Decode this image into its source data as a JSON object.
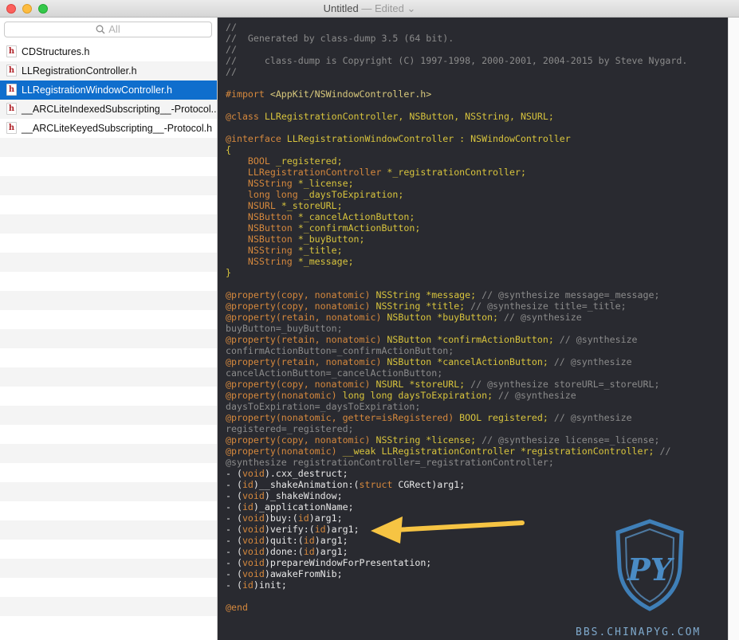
{
  "window": {
    "title": "Untitled",
    "edited": "— Edited",
    "traffic_lights": [
      "close",
      "minimize",
      "maximize"
    ]
  },
  "sidebar": {
    "search_placeholder": "All",
    "files": [
      {
        "name": "CDStructures.h",
        "selected": false
      },
      {
        "name": "LLRegistrationController.h",
        "selected": false
      },
      {
        "name": "LLRegistrationWindowController.h",
        "selected": true
      },
      {
        "name": "__ARCLiteIndexedSubscripting__-Protocol...",
        "selected": false
      },
      {
        "name": "__ARCLiteKeyedSubscripting__-Protocol.h",
        "selected": false
      }
    ]
  },
  "code_lines": [
    [
      {
        "c": "c",
        "t": "//"
      }
    ],
    [
      {
        "c": "c",
        "t": "//  Generated by class-dump 3.5 (64 bit)."
      }
    ],
    [
      {
        "c": "c",
        "t": "//"
      }
    ],
    [
      {
        "c": "c",
        "t": "//     class-dump is Copyright (C) 1997-1998, 2000-2001, 2004-2015 by Steve Nygard."
      }
    ],
    [
      {
        "c": "c",
        "t": "//"
      }
    ],
    [
      {
        "c": "w",
        "t": ""
      }
    ],
    [
      {
        "c": "k",
        "t": "#import "
      },
      {
        "c": "s",
        "t": "<AppKit/NSWindowController.h>"
      }
    ],
    [
      {
        "c": "w",
        "t": ""
      }
    ],
    [
      {
        "c": "k",
        "t": "@class "
      },
      {
        "c": "y",
        "t": "LLRegistrationController, NSButton, NSString, NSURL;"
      }
    ],
    [
      {
        "c": "w",
        "t": ""
      }
    ],
    [
      {
        "c": "k",
        "t": "@interface "
      },
      {
        "c": "y",
        "t": "LLRegistrationWindowController : NSWindowController"
      }
    ],
    [
      {
        "c": "y",
        "t": "{"
      }
    ],
    [
      {
        "c": "k",
        "t": "    BOOL"
      },
      {
        "c": "y",
        "t": " _registered;"
      }
    ],
    [
      {
        "c": "k",
        "t": "    LLRegistrationController"
      },
      {
        "c": "y",
        "t": " *_registrationController;"
      }
    ],
    [
      {
        "c": "k",
        "t": "    NSString"
      },
      {
        "c": "y",
        "t": " *_license;"
      }
    ],
    [
      {
        "c": "k",
        "t": "    long long"
      },
      {
        "c": "y",
        "t": " _daysToExpiration;"
      }
    ],
    [
      {
        "c": "k",
        "t": "    NSURL"
      },
      {
        "c": "y",
        "t": " *_storeURL;"
      }
    ],
    [
      {
        "c": "k",
        "t": "    NSButton"
      },
      {
        "c": "y",
        "t": " *_cancelActionButton;"
      }
    ],
    [
      {
        "c": "k",
        "t": "    NSButton"
      },
      {
        "c": "y",
        "t": " *_confirmActionButton;"
      }
    ],
    [
      {
        "c": "k",
        "t": "    NSButton"
      },
      {
        "c": "y",
        "t": " *_buyButton;"
      }
    ],
    [
      {
        "c": "k",
        "t": "    NSString"
      },
      {
        "c": "y",
        "t": " *_title;"
      }
    ],
    [
      {
        "c": "k",
        "t": "    NSString"
      },
      {
        "c": "y",
        "t": " *_message;"
      }
    ],
    [
      {
        "c": "y",
        "t": "}"
      }
    ],
    [
      {
        "c": "w",
        "t": ""
      }
    ],
    [
      {
        "c": "k",
        "t": "@property(copy, nonatomic) "
      },
      {
        "c": "y",
        "t": "NSString *message;"
      },
      {
        "c": "c",
        "t": " // @synthesize message=_message;"
      }
    ],
    [
      {
        "c": "k",
        "t": "@property(copy, nonatomic) "
      },
      {
        "c": "y",
        "t": "NSString *title;"
      },
      {
        "c": "c",
        "t": " // @synthesize title=_title;"
      }
    ],
    [
      {
        "c": "k",
        "t": "@property(retain, nonatomic) "
      },
      {
        "c": "y",
        "t": "NSButton *buyButton;"
      },
      {
        "c": "c",
        "t": " // @synthesize"
      }
    ],
    [
      {
        "c": "c",
        "t": "buyButton=_buyButton;"
      }
    ],
    [
      {
        "c": "k",
        "t": "@property(retain, nonatomic) "
      },
      {
        "c": "y",
        "t": "NSButton *confirmActionButton;"
      },
      {
        "c": "c",
        "t": " // @synthesize"
      }
    ],
    [
      {
        "c": "c",
        "t": "confirmActionButton=_confirmActionButton;"
      }
    ],
    [
      {
        "c": "k",
        "t": "@property(retain, nonatomic) "
      },
      {
        "c": "y",
        "t": "NSButton *cancelActionButton;"
      },
      {
        "c": "c",
        "t": " // @synthesize"
      }
    ],
    [
      {
        "c": "c",
        "t": "cancelActionButton=_cancelActionButton;"
      }
    ],
    [
      {
        "c": "k",
        "t": "@property(copy, nonatomic) "
      },
      {
        "c": "y",
        "t": "NSURL *storeURL;"
      },
      {
        "c": "c",
        "t": " // @synthesize storeURL=_storeURL;"
      }
    ],
    [
      {
        "c": "k",
        "t": "@property(nonatomic) "
      },
      {
        "c": "y",
        "t": "long long daysToExpiration;"
      },
      {
        "c": "c",
        "t": " // @synthesize"
      }
    ],
    [
      {
        "c": "c",
        "t": "daysToExpiration=_daysToExpiration;"
      }
    ],
    [
      {
        "c": "k",
        "t": "@property(nonatomic, getter=isRegistered) "
      },
      {
        "c": "y",
        "t": "BOOL registered;"
      },
      {
        "c": "c",
        "t": " // @synthesize"
      }
    ],
    [
      {
        "c": "c",
        "t": "registered=_registered;"
      }
    ],
    [
      {
        "c": "k",
        "t": "@property(copy, nonatomic) "
      },
      {
        "c": "y",
        "t": "NSString *license;"
      },
      {
        "c": "c",
        "t": " // @synthesize license=_license;"
      }
    ],
    [
      {
        "c": "k",
        "t": "@property(nonatomic) "
      },
      {
        "c": "y",
        "t": "__weak LLRegistrationController *registrationController;"
      },
      {
        "c": "c",
        "t": " //"
      }
    ],
    [
      {
        "c": "c",
        "t": "@synthesize registrationController=_registrationController;"
      }
    ],
    [
      {
        "c": "w",
        "t": "- ("
      },
      {
        "c": "k",
        "t": "void"
      },
      {
        "c": "w",
        "t": ").cxx_destruct;"
      }
    ],
    [
      {
        "c": "w",
        "t": "- ("
      },
      {
        "c": "k",
        "t": "id"
      },
      {
        "c": "w",
        "t": ")__shakeAnimation:("
      },
      {
        "c": "k",
        "t": "struct"
      },
      {
        "c": "w",
        "t": " CGRect)arg1;"
      }
    ],
    [
      {
        "c": "w",
        "t": "- ("
      },
      {
        "c": "k",
        "t": "void"
      },
      {
        "c": "w",
        "t": ")_shakeWindow;"
      }
    ],
    [
      {
        "c": "w",
        "t": "- ("
      },
      {
        "c": "k",
        "t": "id"
      },
      {
        "c": "w",
        "t": ")_applicationName;"
      }
    ],
    [
      {
        "c": "w",
        "t": "- ("
      },
      {
        "c": "k",
        "t": "void"
      },
      {
        "c": "w",
        "t": ")buy:("
      },
      {
        "c": "k",
        "t": "id"
      },
      {
        "c": "w",
        "t": ")arg1;"
      }
    ],
    [
      {
        "c": "w",
        "t": "- ("
      },
      {
        "c": "k",
        "t": "void"
      },
      {
        "c": "w",
        "t": ")verify:("
      },
      {
        "c": "k",
        "t": "id"
      },
      {
        "c": "w",
        "t": ")arg1;"
      }
    ],
    [
      {
        "c": "w",
        "t": "- ("
      },
      {
        "c": "k",
        "t": "void"
      },
      {
        "c": "w",
        "t": ")quit:("
      },
      {
        "c": "k",
        "t": "id"
      },
      {
        "c": "w",
        "t": ")arg1;"
      }
    ],
    [
      {
        "c": "w",
        "t": "- ("
      },
      {
        "c": "k",
        "t": "void"
      },
      {
        "c": "w",
        "t": ")done:("
      },
      {
        "c": "k",
        "t": "id"
      },
      {
        "c": "w",
        "t": ")arg1;"
      }
    ],
    [
      {
        "c": "w",
        "t": "- ("
      },
      {
        "c": "k",
        "t": "void"
      },
      {
        "c": "w",
        "t": ")prepareWindowForPresentation;"
      }
    ],
    [
      {
        "c": "w",
        "t": "- ("
      },
      {
        "c": "k",
        "t": "void"
      },
      {
        "c": "w",
        "t": ")awakeFromNib;"
      }
    ],
    [
      {
        "c": "w",
        "t": "- ("
      },
      {
        "c": "k",
        "t": "id"
      },
      {
        "c": "w",
        "t": ")init;"
      }
    ],
    [
      {
        "c": "w",
        "t": ""
      }
    ],
    [
      {
        "c": "k",
        "t": "@end"
      }
    ]
  ],
  "watermark": {
    "text": "BBS.CHINAPYG.COM",
    "logo_text": "PY"
  },
  "colors": {
    "editor_bg": "#292a30",
    "selection": "#0f6ecd",
    "keyword": "#d5883d",
    "type": "#d8c43d",
    "comment": "#8b8b8b",
    "arrow": "#f6c443"
  }
}
